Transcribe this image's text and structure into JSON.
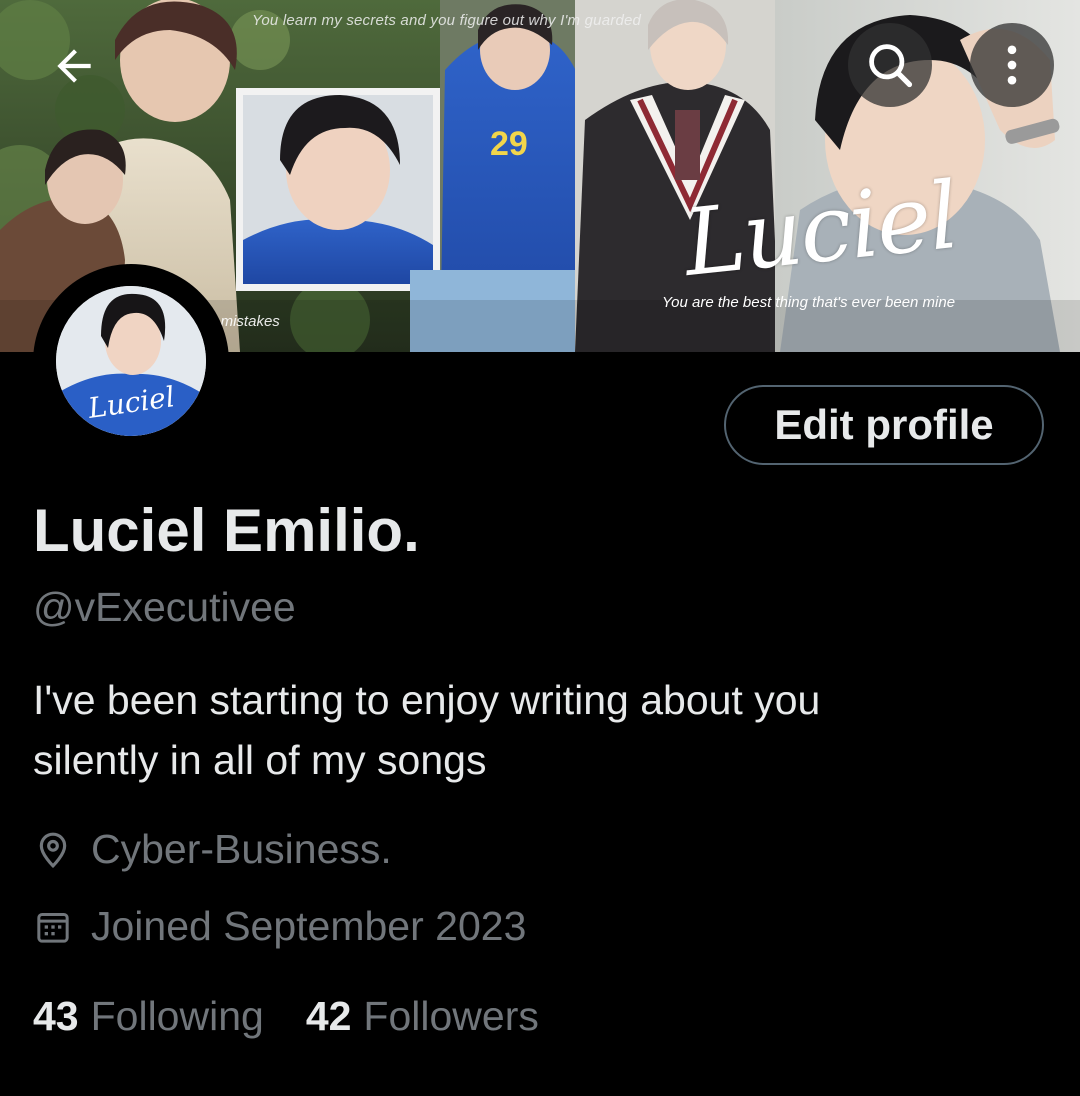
{
  "banner": {
    "caption_top": "You learn my secrets and you figure out why I'm guarded",
    "caption_right": "You are the best thing that's ever been mine",
    "caption_left": "You... make my parents' mistakes",
    "script_text": "Luciel",
    "hoodie_text": "29"
  },
  "nav": {
    "back_icon": "arrow-left-icon",
    "search_icon": "search-icon",
    "more_icon": "more-vertical-icon"
  },
  "avatar": {
    "script_text": "Luciel"
  },
  "profile": {
    "edit_label": "Edit profile",
    "display_name": "Luciel Emilio.",
    "handle": "@vExecutivee",
    "bio_line1": "I've been starting to enjoy writing about you",
    "bio_line2": "silently in all of my songs",
    "location": "Cyber-Business.",
    "joined": "Joined September 2023",
    "following_count": "43",
    "following_label": "Following",
    "followers_count": "42",
    "followers_label": "Followers"
  },
  "colors": {
    "background": "#000000",
    "primary_text": "#e7e9ea",
    "secondary_text": "#71767b",
    "button_border": "#536471"
  }
}
